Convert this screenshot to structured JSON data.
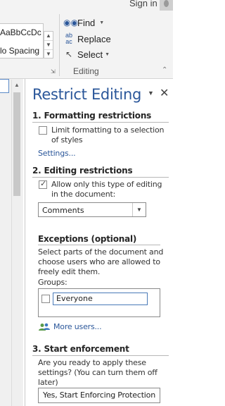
{
  "header": {
    "sign_in": "Sign in"
  },
  "styles_group": {
    "style_preview_1": "AaBbCcDc",
    "style_preview_2": "lo Spacing"
  },
  "editing_group": {
    "find_label": "Find",
    "replace_label": "Replace",
    "select_label": "Select",
    "group_label": "Editing"
  },
  "pane": {
    "title": "Restrict Editing",
    "section1": {
      "heading": "1. Formatting restrictions",
      "checkbox_line1": "Limit formatting to a selection",
      "checkbox_line2": "of styles",
      "checkbox_checked": false,
      "settings_link": "Settings..."
    },
    "section2": {
      "heading": "2. Editing restrictions",
      "checkbox_line1": "Allow only this type of editing",
      "checkbox_line2": "in the document:",
      "checkbox_checked": true,
      "editing_type": "Comments",
      "exceptions_heading": "Exceptions (optional)",
      "exceptions_line1": "Select parts of the document and",
      "exceptions_line2": "choose users who are allowed to",
      "exceptions_line3": "freely edit them.",
      "groups_label": "Groups:",
      "group_name": "Everyone",
      "more_users_link": "More users..."
    },
    "section3": {
      "heading": "3. Start enforcement",
      "text_line1": "Are you ready to apply these",
      "text_line2": "settings? (You can turn them off",
      "text_line3": "later)",
      "button_label": "Yes, Start Enforcing Protection"
    }
  },
  "icons": {
    "find": "binoculars-icon",
    "replace": "replace-icon",
    "select": "cursor-icon",
    "more_users": "users-icon",
    "close": "close-icon"
  },
  "colors": {
    "accent": "#2b579a",
    "ribbon_bg": "#f3f3f3",
    "rule": "#b7b7b7"
  }
}
